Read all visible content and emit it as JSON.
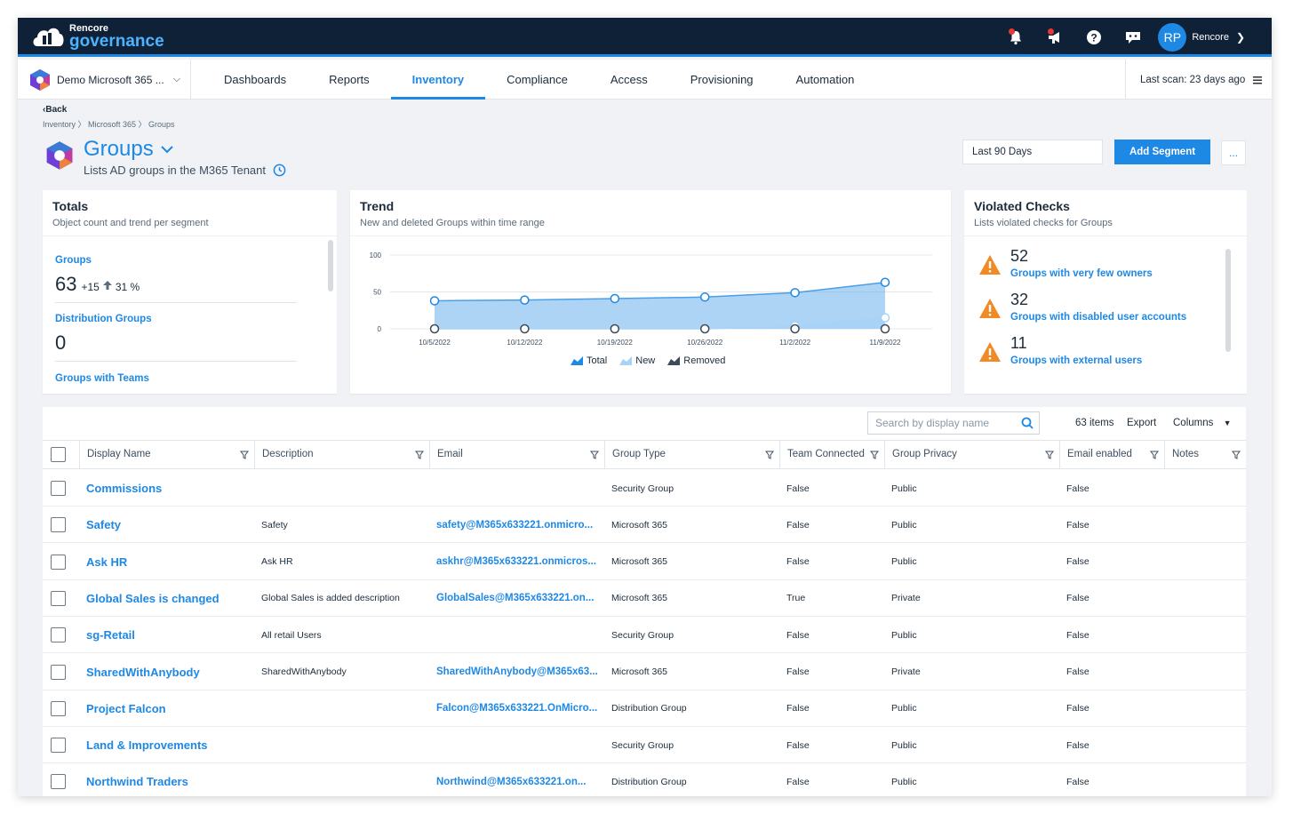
{
  "app": {
    "logo_small": "Rencore",
    "logo_big": "governance"
  },
  "topbar": {
    "avatar_initials": "RP",
    "user_name": "Rencore"
  },
  "tenant": {
    "name": "Demo Microsoft 365 ..."
  },
  "nav": {
    "tabs": [
      {
        "label": "Dashboards"
      },
      {
        "label": "Reports"
      },
      {
        "label": "Inventory"
      },
      {
        "label": "Compliance"
      },
      {
        "label": "Access"
      },
      {
        "label": "Provisioning"
      },
      {
        "label": "Automation"
      }
    ],
    "active_tab": "Inventory",
    "last_scan": "Last scan: 23 days ago"
  },
  "page": {
    "back": "Back",
    "breadcrumb": "Inventory 〉 Microsoft 365 〉 Groups",
    "title": "Groups",
    "subtitle": "Lists AD groups in the M365 Tenant",
    "range": "Last 90 Days",
    "add_segment": "Add Segment",
    "more": "..."
  },
  "totals": {
    "title": "Totals",
    "subtitle": "Object count and trend per segment",
    "items": [
      {
        "label": "Groups",
        "value": "63",
        "delta": "+15",
        "pct": "31 %"
      },
      {
        "label": "Distribution Groups",
        "value": "0"
      },
      {
        "label": "Groups with Teams"
      }
    ]
  },
  "trend": {
    "title": "Trend",
    "subtitle": "New and deleted Groups within time range",
    "legend": [
      "Total",
      "New",
      "Removed"
    ]
  },
  "chart_data": {
    "type": "area",
    "x": [
      "10/5/2022",
      "10/12/2022",
      "10/19/2022",
      "10/26/2022",
      "11/2/2022",
      "11/9/2022"
    ],
    "yticks": [
      "100",
      "50",
      "0"
    ],
    "ylim": [
      0,
      100
    ],
    "series": [
      {
        "name": "Total",
        "values": [
          38,
          39,
          41,
          43,
          49,
          63
        ]
      },
      {
        "name": "New",
        "values": [
          0,
          0,
          0,
          0,
          4,
          15
        ]
      },
      {
        "name": "Removed",
        "values": [
          0,
          0,
          0,
          0,
          0,
          0
        ]
      }
    ],
    "colors": {
      "Total": "#4a9fe8",
      "New": "#a6d3f7",
      "Removed": "#3c4a5a"
    }
  },
  "violated": {
    "title": "Violated Checks",
    "subtitle": "Lists violated checks for Groups",
    "items": [
      {
        "count": "52",
        "label": "Groups with very few owners"
      },
      {
        "count": "32",
        "label": "Groups with disabled user accounts"
      },
      {
        "count": "11",
        "label": "Groups with external users"
      }
    ]
  },
  "table": {
    "search_placeholder": "Search by display name",
    "count": "63 items",
    "export": "Export",
    "columns_label": "Columns",
    "headers": [
      "Display Name",
      "Description",
      "Email",
      "Group Type",
      "Team Connected",
      "Group Privacy",
      "Email enabled",
      "Notes"
    ],
    "rows": [
      {
        "name": "Commissions",
        "desc": "",
        "email": "",
        "type": "Security Group",
        "team": "False",
        "privacy": "Public",
        "enabled": "False"
      },
      {
        "name": "Safety",
        "desc": "Safety",
        "email": "safety@M365x633221.onmicro...",
        "type": "Microsoft 365",
        "team": "False",
        "privacy": "Public",
        "enabled": "False"
      },
      {
        "name": "Ask HR",
        "desc": "Ask HR",
        "email": "askhr@M365x633221.onmicros...",
        "type": "Microsoft 365",
        "team": "False",
        "privacy": "Public",
        "enabled": "False"
      },
      {
        "name": "Global Sales is changed",
        "desc": "Global Sales is added description",
        "email": "GlobalSales@M365x633221.on...",
        "type": "Microsoft 365",
        "team": "True",
        "privacy": "Private",
        "enabled": "False"
      },
      {
        "name": "sg-Retail",
        "desc": "All retail Users",
        "email": "",
        "type": "Security Group",
        "team": "False",
        "privacy": "Public",
        "enabled": "False"
      },
      {
        "name": "SharedWithAnybody",
        "desc": "SharedWithAnybody",
        "email": "SharedWithAnybody@M365x63...",
        "type": "Microsoft 365",
        "team": "False",
        "privacy": "Private",
        "enabled": "False"
      },
      {
        "name": "Project Falcon",
        "desc": "",
        "email": "Falcon@M365x633221.OnMicro...",
        "type": "Distribution Group",
        "team": "False",
        "privacy": "Public",
        "enabled": "False"
      },
      {
        "name": "Land & Improvements",
        "desc": "",
        "email": "",
        "type": "Security Group",
        "team": "False",
        "privacy": "Public",
        "enabled": "False"
      },
      {
        "name": "Northwind Traders",
        "desc": "",
        "email": "Northwind@M365x633221.on...",
        "type": "Distribution Group",
        "team": "False",
        "privacy": "Public",
        "enabled": "False"
      }
    ]
  }
}
